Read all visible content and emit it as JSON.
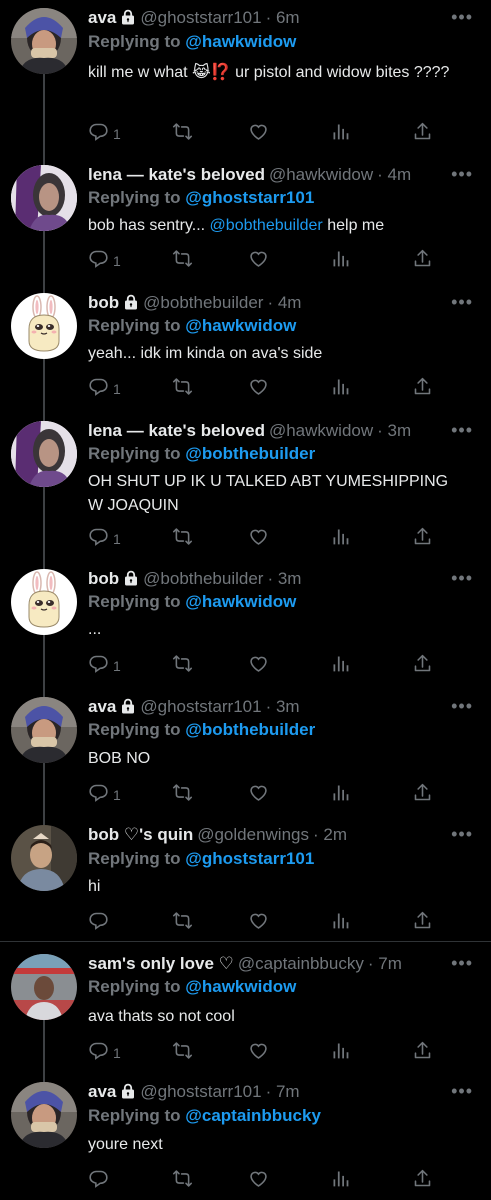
{
  "icons": {
    "reply": "reply-icon",
    "retweet": "retweet-icon",
    "like": "like-icon",
    "views": "views-icon",
    "share": "share-icon",
    "more": "more-icon",
    "lock": "lock-icon"
  },
  "colors": {
    "background": "#000000",
    "link": "#1d9bf0",
    "muted": "#71767b",
    "text": "#e7e9ea"
  },
  "tweets": [
    {
      "name": "ava",
      "locked": true,
      "handle": "@ghoststarr101",
      "time": "· 6m",
      "replying_label": "Replying to",
      "replying_to": "@hawkwidow",
      "text_a": "kill me w what",
      "emoji": "😹⁉️",
      "text_b": " ur pistol and widow bites ????",
      "reply_count": "1",
      "avatar": "ava"
    },
    {
      "name": "lena — kate's beloved",
      "locked": false,
      "handle": "@hawkwidow",
      "time": "· 4m",
      "replying_label": "Replying to",
      "replying_to": "@ghoststarr101",
      "text_a": "bob has sentry... ",
      "mention": "@bobthebuilder",
      "text_b": " help me",
      "reply_count": "1",
      "avatar": "lena"
    },
    {
      "name": "bob",
      "locked": true,
      "handle": "@bobthebuilder",
      "time": "· 4m",
      "replying_label": "Replying to",
      "replying_to": "@hawkwidow",
      "text": "yeah... idk im kinda on ava's side",
      "reply_count": "1",
      "avatar": "bob"
    },
    {
      "name": "lena — kate's beloved",
      "locked": false,
      "handle": "@hawkwidow",
      "time": "· 3m",
      "replying_label": "Replying to",
      "replying_to": "@bobthebuilder",
      "text": "OH SHUT UP IK U TALKED ABT YUMESHIPPING W JOAQUIN",
      "reply_count": "1",
      "avatar": "lena"
    },
    {
      "name": "bob",
      "locked": true,
      "handle": "@bobthebuilder",
      "time": "· 3m",
      "replying_label": "Replying to",
      "replying_to": "@hawkwidow",
      "text": "...",
      "reply_count": "1",
      "avatar": "bob"
    },
    {
      "name": "ava",
      "locked": true,
      "handle": "@ghoststarr101",
      "time": "· 3m",
      "replying_label": "Replying to",
      "replying_to": "@bobthebuilder",
      "text": "BOB NO",
      "reply_count": "1",
      "avatar": "ava"
    },
    {
      "name": "bob ♡'s quin",
      "locked": false,
      "handle": "@goldenwings",
      "time": "· 2m",
      "replying_label": "Replying to",
      "replying_to": "@ghoststarr101",
      "text": "hi",
      "reply_count": "",
      "avatar": "quin"
    },
    {
      "name": "sam's only love ♡",
      "locked": false,
      "handle": "@captainbbucky",
      "time": "· 7m",
      "replying_label": "Replying to",
      "replying_to": "@hawkwidow",
      "text": "ava thats so not cool",
      "reply_count": "1",
      "avatar": "sam"
    },
    {
      "name": "ava",
      "locked": true,
      "handle": "@ghoststarr101",
      "time": "· 7m",
      "replying_label": "Replying to",
      "replying_to": "@captainbbucky",
      "text": "youre next",
      "reply_count": "",
      "avatar": "ava"
    }
  ]
}
